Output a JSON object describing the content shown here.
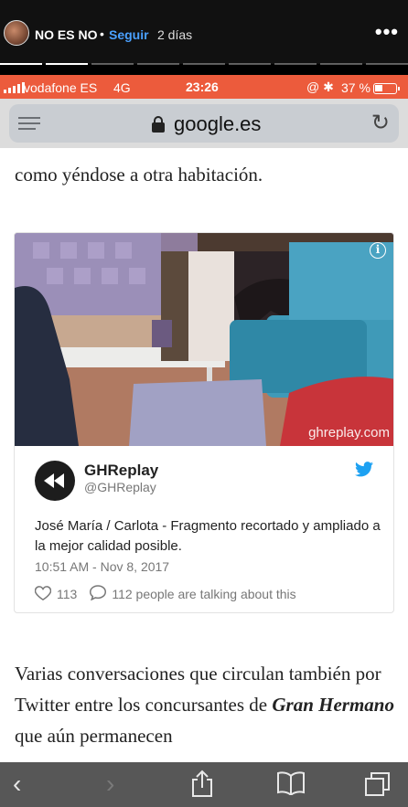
{
  "story": {
    "username": "NO ES NO",
    "separator": "•",
    "follow_label": "Seguir",
    "time_ago": "2 días",
    "more_label": "•••"
  },
  "status_bar": {
    "carrier": "vodafone ES",
    "network": "4G",
    "time": "23:26",
    "icons": "@ ✱",
    "battery": "37 %"
  },
  "browser": {
    "url": "google.es"
  },
  "article": {
    "para_top": "como yéndose a otra habitación.",
    "para_bottom_1": "Varias conversaciones que circulan también por Twitter entre los concursantes de ",
    "para_bottom_bold": "Gran Hermano",
    "para_bottom_2": " que aún permanecen"
  },
  "tweet": {
    "watermark": "ghreplay.com",
    "display_name": "GHReplay",
    "handle": "@GHReplay",
    "text": "José María / Carlota - Fragmento recortado y ampliado a la mejor calidad posible.",
    "date": "10:51 AM - Nov 8, 2017",
    "likes": "113",
    "talking": "112 people are talking about this"
  },
  "colors": {
    "status_bar": "#ec5b3c",
    "follow": "#4aa0ff",
    "twitter_blue": "#1da1f2"
  }
}
